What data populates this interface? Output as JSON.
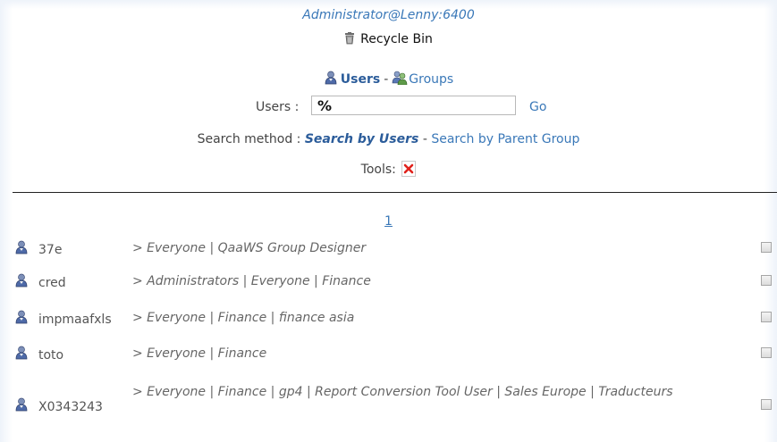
{
  "header": {
    "admin_link": "Administrator@Lenny:6400",
    "recycle_bin": "Recycle Bin",
    "users_tab": "Users",
    "separator": "-",
    "groups_tab": "Groups"
  },
  "search": {
    "label": "Users :",
    "value": "%",
    "go": "Go",
    "method_label": "Search method :",
    "method_active": "Search by Users",
    "method_separator": "-",
    "method_other": "Search by Parent Group",
    "tools_label": "Tools:"
  },
  "pager": {
    "page": "1"
  },
  "users": [
    {
      "name": "37e",
      "groups": "> Everyone | QaaWS Group Designer",
      "checked": false
    },
    {
      "name": "cred",
      "groups": "> Administrators | Everyone | Finance",
      "checked": false
    },
    {
      "name": "impmaafxls",
      "groups": "> Everyone | Finance | finance asia",
      "checked": false
    },
    {
      "name": "toto",
      "groups": "> Everyone | Finance",
      "checked": false
    },
    {
      "name": "X0343243",
      "groups": "> Everyone | Finance | gp4 | Report Conversion Tool User | Sales Europe | Traducteurs",
      "checked": false
    }
  ],
  "icons": {
    "user": "user-icon",
    "users_group": "group-icon",
    "recycle": "recycle-bin-icon",
    "tools": "delete-x-icon"
  },
  "colors": {
    "link": "#3a78b8",
    "link_active": "#2b5c9a",
    "delete_red": "#e0211b"
  }
}
